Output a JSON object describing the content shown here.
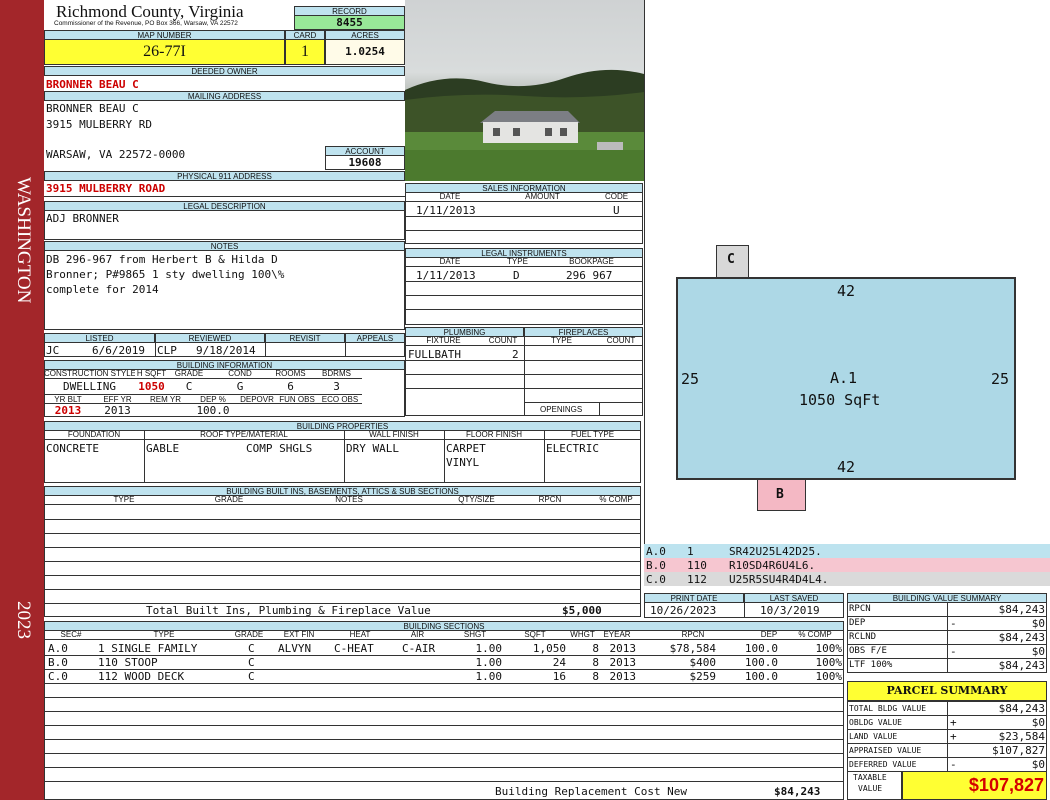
{
  "sidebar": {
    "top": "WASHINGTON",
    "year": "2023"
  },
  "header": {
    "county": "Richmond County, Virginia",
    "commissioner": "Commissioner of the Revenue, PO Box 366, Warsaw, VA 22572",
    "record_label": "RECORD",
    "record": "8455",
    "map_label": "MAP NUMBER",
    "map": "26-77I",
    "card_label": "CARD",
    "card": "1",
    "acres_label": "ACRES",
    "acres": "1.0254"
  },
  "owner": {
    "label": "DEEDED OWNER",
    "name": "BRONNER BEAU C"
  },
  "mailing": {
    "label": "MAILING ADDRESS",
    "line1": "BRONNER BEAU C",
    "line2": "3915 MULBERRY RD",
    "line3": "WARSAW, VA 22572-0000",
    "account_label": "ACCOUNT",
    "account": "19608"
  },
  "physical": {
    "label": "PHYSICAL 911 ADDRESS",
    "address": "3915 MULBERRY ROAD"
  },
  "legal": {
    "label": "LEGAL DESCRIPTION",
    "text": "ADJ BRONNER"
  },
  "notes": {
    "label": "NOTES",
    "line1": "DB 296-967 from Herbert B & Hilda D",
    "line2": "Bronner; P#9865 1 sty dwelling 100\\%",
    "line3": "complete for 2014"
  },
  "listed": {
    "listed_label": "LISTED",
    "reviewed_label": "REVIEWED",
    "revisit_label": "REVISIT",
    "appeals_label": "APPEALS",
    "lister": "JC",
    "listed_date": "6/6/2019",
    "reviewer": "CLP",
    "reviewed_date": "9/18/2014"
  },
  "building_info": {
    "label": "BUILDING INFORMATION",
    "h": [
      "CONSTRUCTION STYLE",
      "H SQFT",
      "GRADE",
      "COND",
      "ROOMS",
      "BDRMS"
    ],
    "v": [
      "DWELLING",
      "1050",
      "C",
      "G",
      "6",
      "3"
    ],
    "h2": [
      "YR BLT",
      "EFF YR",
      "REM YR",
      "DEP %",
      "DEPOVR",
      "FUN OBS",
      "ECO OBS"
    ],
    "v2": [
      "2013",
      "2013",
      "",
      "100.0",
      "",
      "",
      ""
    ]
  },
  "sales": {
    "label": "SALES INFORMATION",
    "h": [
      "DATE",
      "AMOUNT",
      "CODE"
    ],
    "date": "1/11/2013",
    "code": "U"
  },
  "legal_instr": {
    "label": "LEGAL INSTRUMENTS",
    "h": [
      "DATE",
      "TYPE",
      "BOOKPAGE"
    ],
    "date": "1/11/2013",
    "type": "D",
    "bookpage": "296 967"
  },
  "plumbing": {
    "label": "PLUMBING",
    "h": [
      "FIXTURE",
      "COUNT"
    ],
    "fixture": "FULLBATH",
    "count": "2"
  },
  "fireplaces": {
    "label": "FIREPLACES",
    "h": [
      "TYPE",
      "COUNT"
    ],
    "openings": "OPENINGS"
  },
  "props": {
    "label": "BUILDING PROPERTIES",
    "h": [
      "FOUNDATION",
      "ROOF TYPE/MATERIAL",
      "WALL FINISH",
      "FLOOR FINISH",
      "FUEL TYPE"
    ],
    "foundation": "CONCRETE",
    "roof1": "GABLE",
    "roof2": "COMP SHGLS",
    "wall": "DRY WALL",
    "floor1": "CARPET",
    "floor2": "VINYL",
    "fuel": "ELECTRIC"
  },
  "builtins": {
    "label": "BUILDING BUILT INS, BASEMENTS, ATTICS & SUB SECTIONS",
    "h": [
      "TYPE",
      "GRADE",
      "NOTES",
      "QTY/SIZE",
      "RPCN",
      "% COMP"
    ],
    "total_label": "Total Built Ins, Plumbing & Fireplace Value",
    "total": "$5,000"
  },
  "print": {
    "print_label": "PRINT DATE",
    "saved_label": "LAST SAVED",
    "print_date": "10/26/2023",
    "saved_date": "10/3/2019"
  },
  "sections": {
    "label": "BUILDING SECTIONS",
    "h": [
      "SEC#",
      "TYPE",
      "GRADE",
      "EXT FIN",
      "HEAT",
      "AIR",
      "SHGT",
      "SQFT",
      "WHGT",
      "EYEAR",
      "RPCN",
      "DEP",
      "% COMP"
    ],
    "rows": [
      [
        "A.0",
        "1 SINGLE FAMILY",
        "C",
        "ALVYN",
        "C-HEAT",
        "C-AIR",
        "1.00",
        "1,050",
        "8",
        "2013",
        "$78,584",
        "100.0",
        "100%"
      ],
      [
        "B.0",
        "110 STOOP",
        "C",
        "",
        "",
        "",
        "1.00",
        "24",
        "8",
        "2013",
        "$400",
        "100.0",
        "100%"
      ],
      [
        "C.0",
        "112 WOOD DECK",
        "C",
        "",
        "",
        "",
        "1.00",
        "16",
        "8",
        "2013",
        "$259",
        "100.0",
        "100%"
      ]
    ],
    "replacement_label": "Building Replacement Cost New",
    "replacement": "$84,243"
  },
  "sketch": {
    "a_label": "A.1",
    "a_area": "1050 SqFt",
    "top": "42",
    "bottom": "42",
    "left": "25",
    "right": "25",
    "b": "B",
    "c": "C",
    "legend": [
      {
        "sec": "A.0",
        "code": "1",
        "vec": "SR42U25L42D25.",
        "color": "#bde3ef"
      },
      {
        "sec": "B.0",
        "code": "110",
        "vec": "R10SD4R6U4L6.",
        "color": "#f6c6d0"
      },
      {
        "sec": "C.0",
        "code": "112",
        "vec": "U25R5SU4R4D4L4.",
        "color": "#dadada"
      }
    ],
    "colors": {
      "main": "#add8e6",
      "b": "#f4b8c4",
      "c": "#d8d8d8"
    }
  },
  "bvs": {
    "label": "BUILDING VALUE SUMMARY",
    "rows": [
      [
        "RPCN",
        "",
        "$84,243"
      ],
      [
        "DEP",
        "-",
        "$0"
      ],
      [
        "RCLND",
        "",
        "$84,243"
      ],
      [
        "OBS F/E",
        "-",
        "$0"
      ],
      [
        "LTF     100%",
        "",
        "$84,243"
      ]
    ]
  },
  "parcel": {
    "label": "PARCEL SUMMARY",
    "rows": [
      [
        "TOTAL BLDG VALUE",
        "",
        "$84,243"
      ],
      [
        "OBLDG VALUE",
        "+",
        "$0"
      ],
      [
        "LAND VALUE",
        "+",
        "$23,584"
      ],
      [
        "APPRAISED VALUE",
        "",
        "$107,827"
      ],
      [
        "DEFERRED VALUE",
        "-",
        "$0"
      ]
    ],
    "taxable_label1": "TAXABLE",
    "taxable_label2": "VALUE",
    "taxable": "$107,827"
  }
}
